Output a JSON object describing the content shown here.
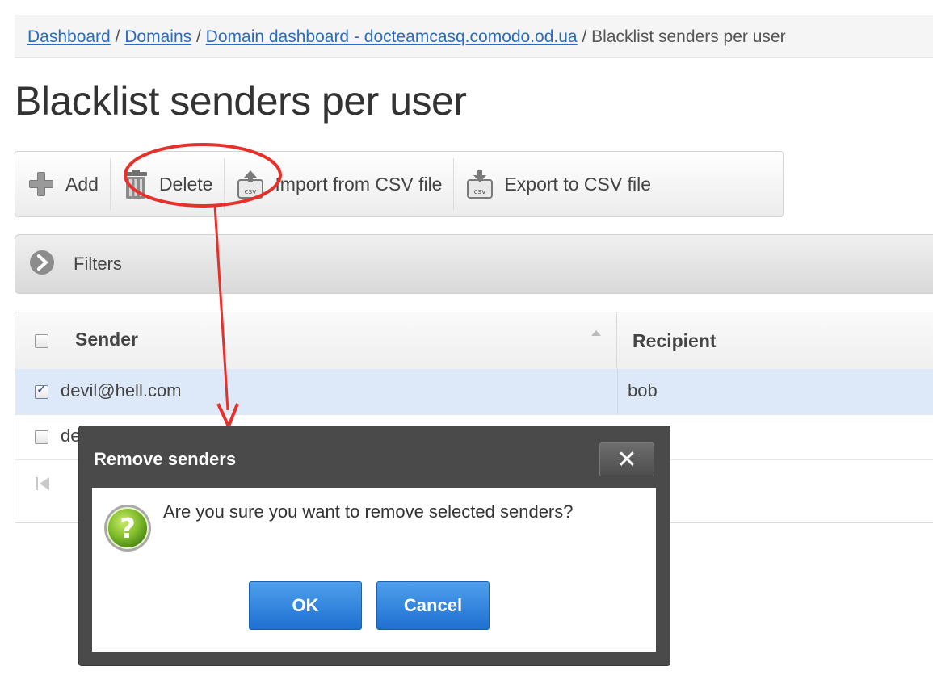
{
  "breadcrumb": {
    "items": [
      "Dashboard",
      "Domains",
      "Domain dashboard - docteamcasq.comodo.od.ua"
    ],
    "separator": "/",
    "current": "Blacklist senders per user"
  },
  "page": {
    "title": "Blacklist senders per user"
  },
  "toolbar": {
    "add_label": "Add",
    "delete_label": "Delete",
    "import_label": "Import from CSV file",
    "export_label": "Export to CSV file",
    "csv_badge": "csv"
  },
  "filters": {
    "label": "Filters"
  },
  "table": {
    "columns": [
      "Sender",
      "Recipient"
    ],
    "rows": [
      {
        "sender": "devil@hell.com",
        "recipient": "bob",
        "checked": true
      },
      {
        "sender": "de",
        "recipient": "",
        "checked": false
      }
    ]
  },
  "dialog": {
    "title": "Remove senders",
    "close_glyph": "✕",
    "message": "Are you sure you want to remove selected senders?",
    "ok_label": "OK",
    "cancel_label": "Cancel",
    "question_glyph": "?"
  },
  "colors": {
    "link": "#2a6cc4",
    "annotation": "#e8302a",
    "selected_row": "#dde9f8",
    "button_blue": "#1f6fd1",
    "dialog_frame": "#4a4a4a"
  }
}
